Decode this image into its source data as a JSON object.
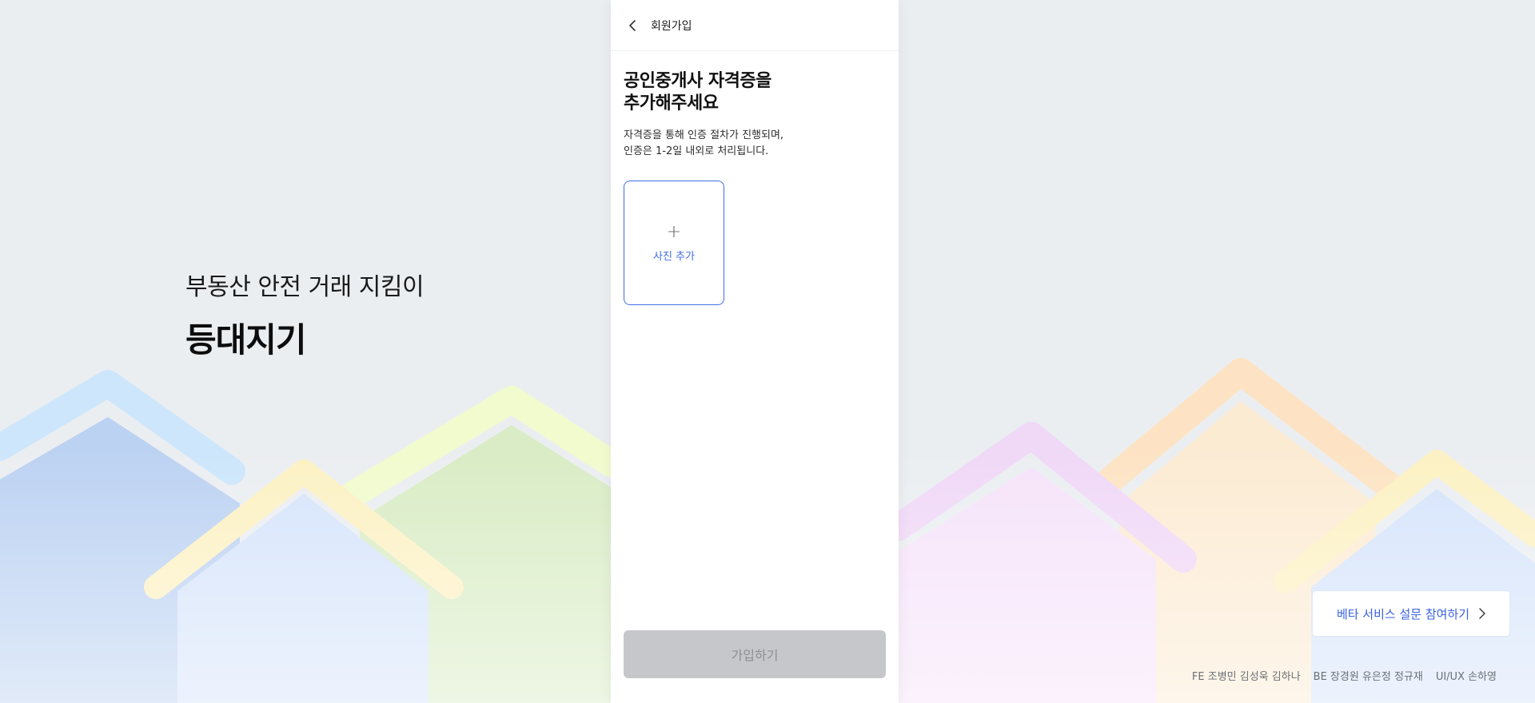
{
  "brand": {
    "tagline": "부동산 안전 거래 지킴이",
    "name": "등대지기"
  },
  "appbar": {
    "title": "회원가입",
    "back_icon": "chevron-left-icon"
  },
  "main": {
    "heading": "공인중개사 자격증을\n추가해주세요",
    "description": "자격증을 통해 인증 절차가 진행되며,\n인증은 1-2일 내외로 처리됩니다.",
    "add_photo": {
      "icon": "plus-icon",
      "icon_glyph": "+",
      "label": "사진 추가"
    }
  },
  "submit": {
    "label": "가입하기",
    "disabled": true
  },
  "survey": {
    "label": "베타 서비스 설문 참여하기",
    "icon": "chevron-right-icon"
  },
  "credits": [
    "FE 조병민 김성욱 김하나",
    "BE 장경원 유은정 정규재",
    "UI/UX 손하영"
  ],
  "colors": {
    "background": "#ebeef1",
    "accent": "#3f6ee8",
    "button_disabled": "#c5c7ca"
  }
}
